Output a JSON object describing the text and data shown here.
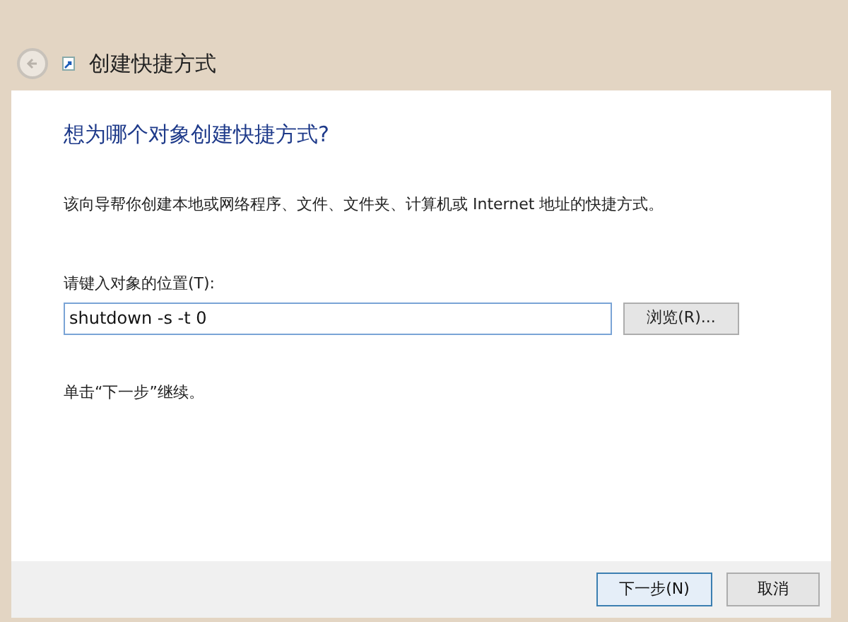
{
  "window": {
    "title": "创建快捷方式"
  },
  "heading": "想为哪个对象创建快捷方式?",
  "description": "该向导帮你创建本地或网络程序、文件、文件夹、计算机或 Internet 地址的快捷方式。",
  "location": {
    "label": "请键入对象的位置(T):",
    "value": "shutdown -s -t 0"
  },
  "browse_button": "浏览(R)...",
  "hint": "单击“下一步”继续。",
  "buttons": [
    {
      "label": "下一步(N)",
      "kind": "primary"
    },
    {
      "label": "取消",
      "kind": "normal"
    }
  ]
}
